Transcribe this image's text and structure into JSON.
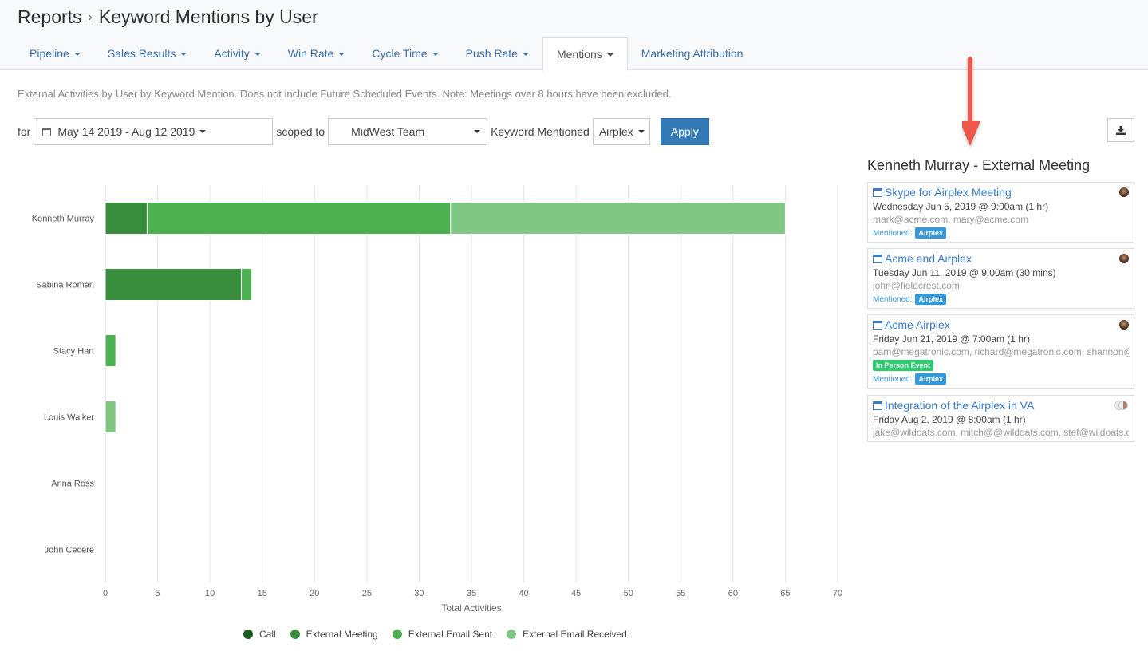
{
  "header": {
    "breadcrumb_root": "Reports",
    "breadcrumb_sep": "›",
    "page_title": "Keyword Mentions by User"
  },
  "tabs": [
    {
      "label": "Pipeline",
      "dropdown": true,
      "active": false
    },
    {
      "label": "Sales Results",
      "dropdown": true,
      "active": false
    },
    {
      "label": "Activity",
      "dropdown": true,
      "active": false
    },
    {
      "label": "Win Rate",
      "dropdown": true,
      "active": false
    },
    {
      "label": "Cycle Time",
      "dropdown": true,
      "active": false
    },
    {
      "label": "Push Rate",
      "dropdown": true,
      "active": false
    },
    {
      "label": "Mentions",
      "dropdown": true,
      "active": true
    },
    {
      "label": "Marketing Attribution",
      "dropdown": false,
      "active": false
    }
  ],
  "note": "External Activities by User by Keyword Mention. Does not include Future Scheduled Events. Note: Meetings over 8 hours have been excluded.",
  "filters": {
    "for_label": "for",
    "date_range": "May 14 2019 - Aug 12 2019",
    "scoped_label": "scoped to",
    "team": "MidWest Team",
    "keyword_label": "Keyword Mentioned",
    "keyword": "Airplex",
    "apply_label": "Apply"
  },
  "icons": {
    "download": "download-icon",
    "calendar": "calendar-icon",
    "annotation_arrow": "red-down-arrow"
  },
  "panel": {
    "title": "Kenneth Murray - External Meeting",
    "mentioned_label": "Mentioned:",
    "events": [
      {
        "title": "Skype for Airplex Meeting",
        "datetime": "Wednesday Jun 5, 2019 @ 9:00am (1 hr)",
        "attendees": "mark@acme.com, mary@acme.com",
        "tags": [],
        "mentioned": [
          "Airplex"
        ],
        "avatar": "stack"
      },
      {
        "title": "Acme and Airplex",
        "datetime": "Tuesday Jun 11, 2019 @ 9:00am (30 mins)",
        "attendees": "john@fieldcrest.com",
        "tags": [],
        "mentioned": [
          "Airplex"
        ],
        "avatar": "single"
      },
      {
        "title": "Acme Airplex",
        "datetime": "Friday Jun 21, 2019 @ 7:00am (1 hr)",
        "attendees": "pam@megatronic.com, richard@megatronic.com, shannon@r",
        "tags": [
          "In Person Event"
        ],
        "mentioned": [
          "Airplex"
        ],
        "avatar": "single"
      },
      {
        "title": "Integration of the Airplex in VA",
        "datetime": "Friday Aug 2, 2019 @ 8:00am (1 hr)",
        "attendees": "jake@wildoats.com, mitch@@wildoats.com, stef@wildoats.co",
        "tags": [],
        "mentioned": [],
        "avatar": "grey"
      }
    ]
  },
  "colors": {
    "accent": "#337ab7",
    "link": "#3a7bc8",
    "badge_blue": "#3498db",
    "badge_green": "#2ecc71",
    "arrow": "#f0564a"
  },
  "chart_data": {
    "type": "bar",
    "orientation": "horizontal",
    "stacked": true,
    "categories": [
      "Kenneth Murray",
      "Sabina Roman",
      "Stacy Hart",
      "Louis Walker",
      "Anna Ross",
      "John Cecere"
    ],
    "series": [
      {
        "name": "Call",
        "color": "#1b5e20",
        "values": [
          0,
          0,
          0,
          0,
          0,
          0
        ]
      },
      {
        "name": "External Meeting",
        "color": "#388e3c",
        "values": [
          4,
          13,
          0,
          0,
          0,
          0
        ]
      },
      {
        "name": "External Email Sent",
        "color": "#4caf50",
        "values": [
          29,
          1,
          1,
          0,
          0,
          0
        ]
      },
      {
        "name": "External Email Received",
        "color": "#81c784",
        "values": [
          32,
          0,
          0,
          1,
          0,
          0
        ]
      }
    ],
    "xlabel": "Total Activities",
    "ylabel": "",
    "xlim": [
      0,
      70
    ],
    "xticks": [
      0,
      5,
      10,
      15,
      20,
      25,
      30,
      35,
      40,
      45,
      50,
      55,
      60,
      65,
      70
    ],
    "grid": true,
    "legend": "bottom"
  }
}
